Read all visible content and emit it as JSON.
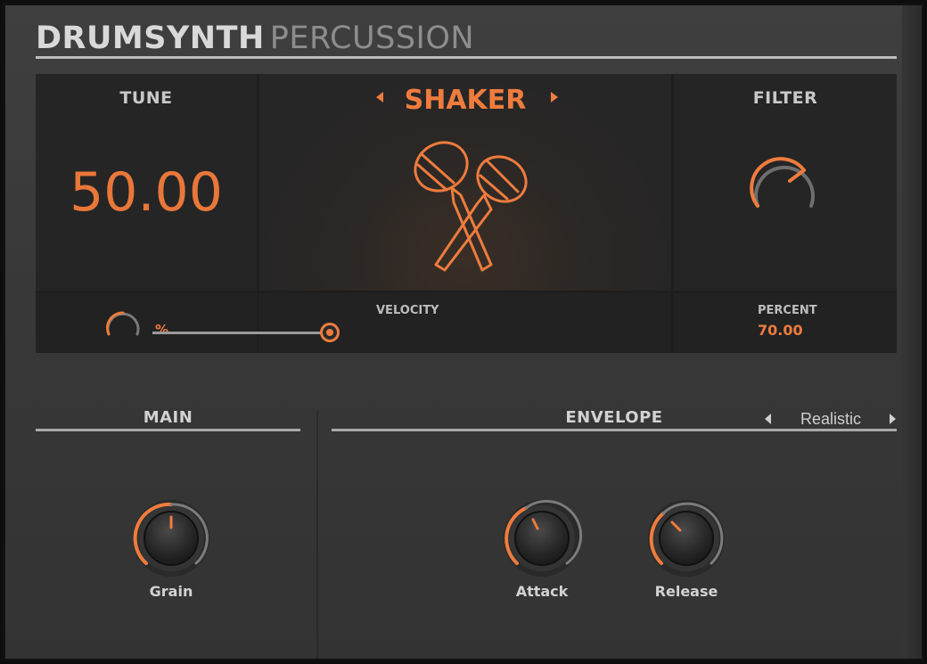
{
  "header": {
    "title_bold": "DRUMSYNTH",
    "title_light": "PERCUSSION"
  },
  "display": {
    "tune": {
      "label": "TUNE",
      "value": "50.00",
      "unit": "%"
    },
    "preset": {
      "name": "SHAKER",
      "icon": "maracas-icon"
    },
    "filter": {
      "label": "FILTER",
      "sub_label": "PERCENT",
      "value": "70.00"
    },
    "velocity": {
      "label": "VELOCITY",
      "level": 0.97
    }
  },
  "main": {
    "title": "MAIN",
    "knobs": [
      {
        "label": "Grain",
        "level": 0.5
      }
    ]
  },
  "envelope": {
    "title": "ENVELOPE",
    "mode": "Realistic",
    "knobs": [
      {
        "label": "Attack",
        "level": 0.38
      },
      {
        "label": "Release",
        "level": 0.3
      }
    ]
  },
  "colors": {
    "accent": "#ee7c3e",
    "panel": "#383838",
    "display": "#252525",
    "text": "#d2d2d2"
  }
}
